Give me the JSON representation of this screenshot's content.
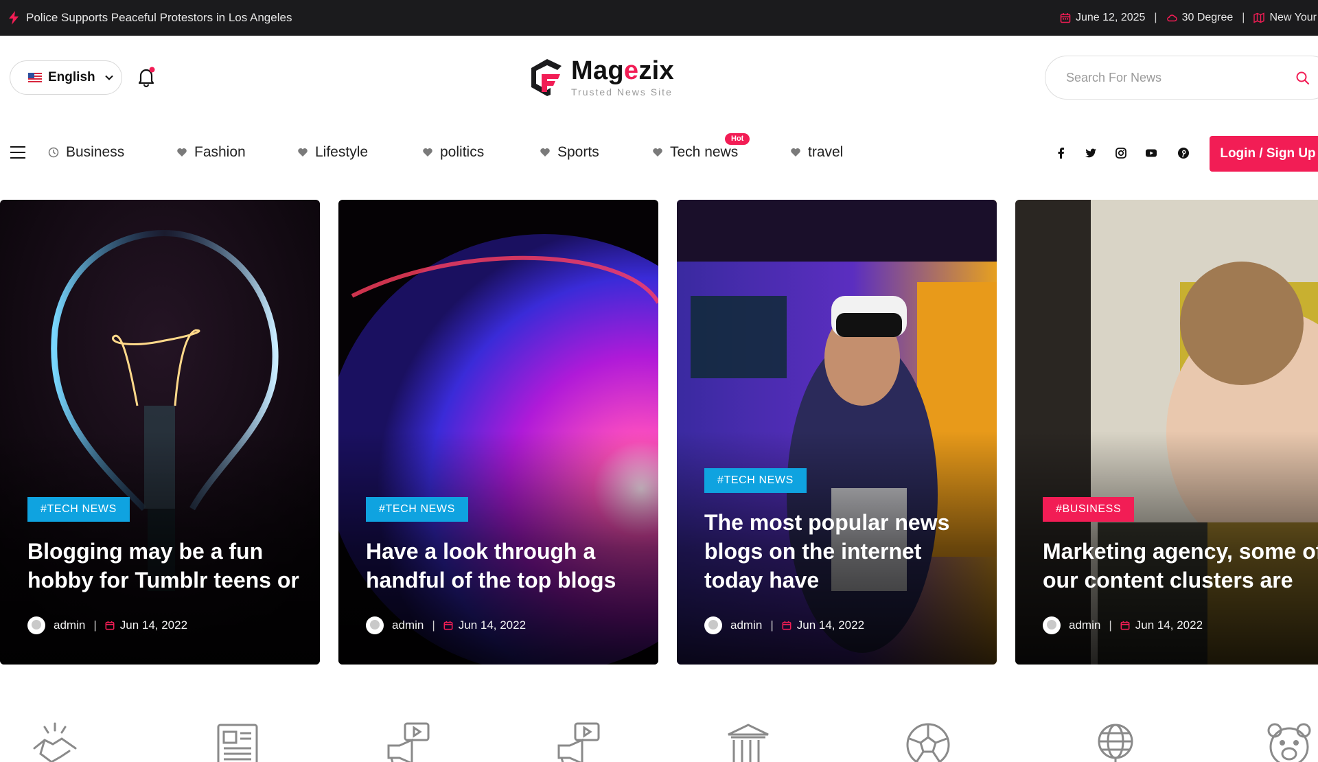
{
  "topbar": {
    "breaking_text": "Police Supports Peaceful Protestors in Los Angeles",
    "date": "June 12, 2025",
    "weather": "30 Degree",
    "location": "New Your"
  },
  "header": {
    "language": "English",
    "logo_name_part1": "Mag",
    "logo_name_accent": "e",
    "logo_name_part2": "zix",
    "logo_tagline": "Trusted News Site",
    "search_placeholder": "Search For News"
  },
  "nav": {
    "items": [
      {
        "label": "Business",
        "icon": "clock-icon"
      },
      {
        "label": "Fashion",
        "icon": "heart-icon"
      },
      {
        "label": "Lifestyle",
        "icon": "heart-icon"
      },
      {
        "label": "politics",
        "icon": "heart-icon"
      },
      {
        "label": "Sports",
        "icon": "heart-icon"
      },
      {
        "label": "Tech news",
        "icon": "heart-icon",
        "badge": "Hot"
      },
      {
        "label": "travel",
        "icon": "heart-icon"
      }
    ],
    "social": [
      "facebook-icon",
      "twitter-icon",
      "instagram-icon",
      "youtube-icon",
      "pinterest-icon"
    ],
    "login_label": "Login / Sign Up"
  },
  "cards": [
    {
      "category": "#TECH NEWS",
      "title": "Blogging may be a fun hobby for Tumblr teens or",
      "author": "admin",
      "date": "Jun 14, 2022"
    },
    {
      "category": "#TECH NEWS",
      "title": "Have a look through a handful of the top blogs",
      "author": "admin",
      "date": "Jun 14, 2022"
    },
    {
      "category": "#TECH NEWS",
      "title": "The most popular news blogs on the internet today have",
      "author": "admin",
      "date": "Jun 14, 2022"
    },
    {
      "category": "#BUSINESS",
      "title": "Marketing agency, some of our content clusters are",
      "author": "admin",
      "date": "Jun 14, 2022"
    }
  ],
  "category_icons": [
    "handshake-icon",
    "newspaper-icon",
    "megaphone-video-icon",
    "megaphone-video-icon",
    "bank-icon",
    "soccer-ball-icon",
    "globe-network-icon",
    "bear-icon"
  ],
  "colors": {
    "accent": "#f21d55",
    "topbar_bg": "#1b1b1d",
    "badge_tech": "#0fa3e0",
    "badge_business": "#f21d55"
  }
}
